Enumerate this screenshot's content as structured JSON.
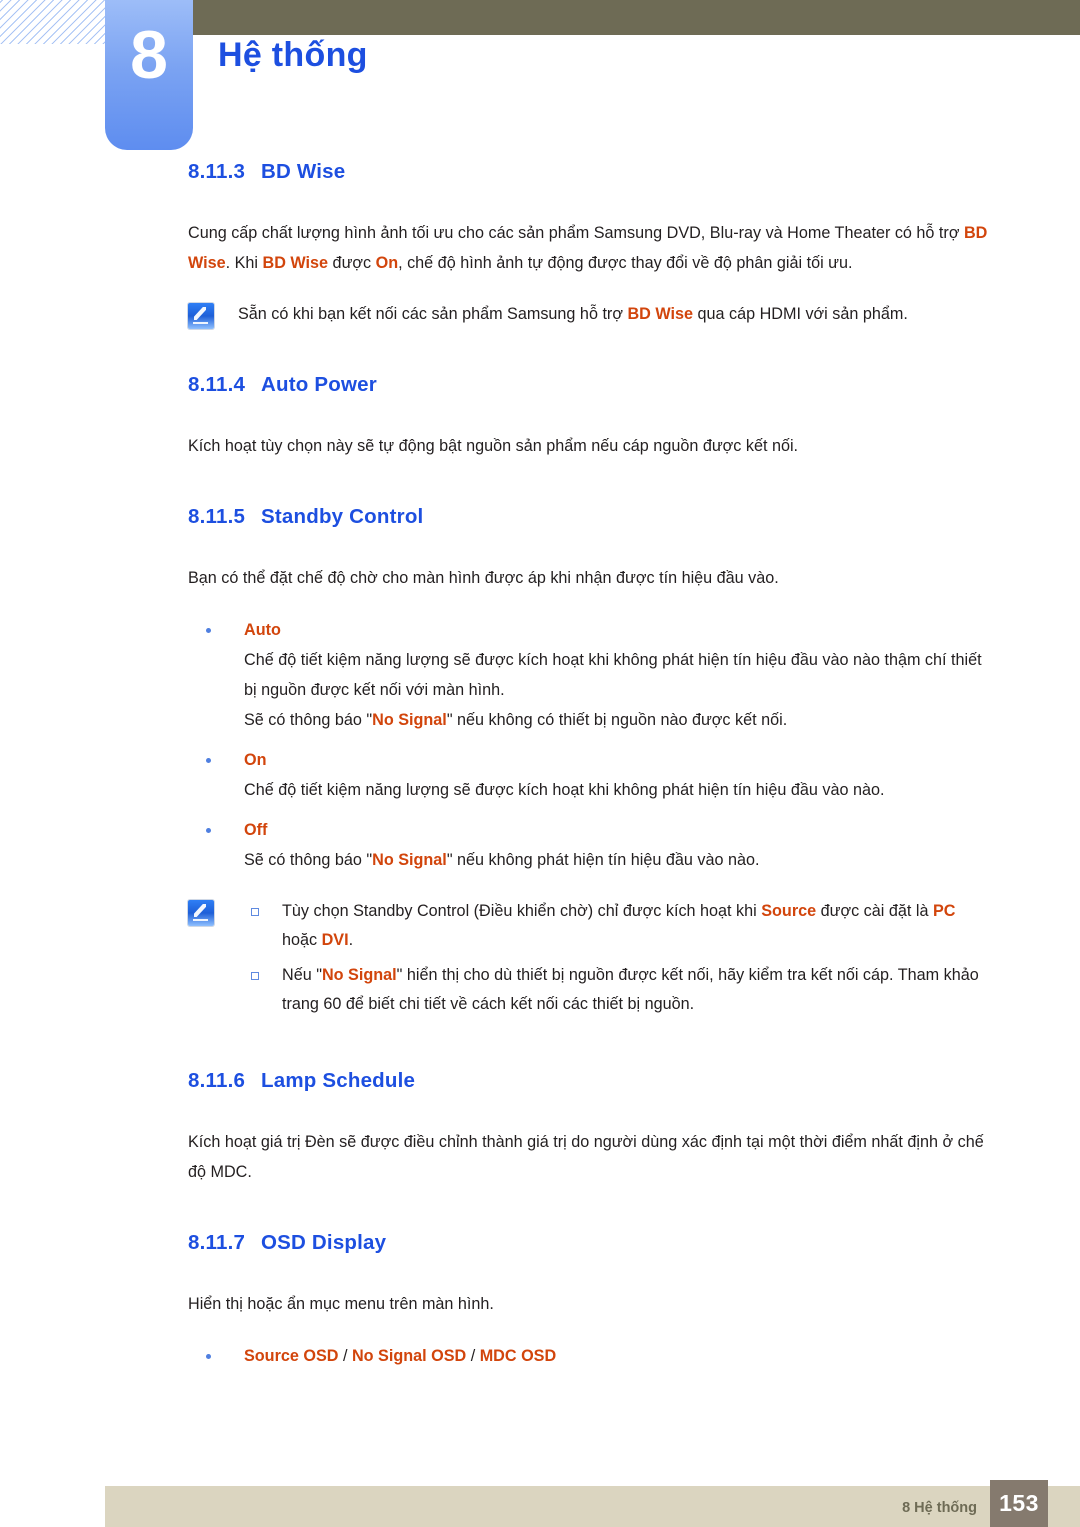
{
  "header": {
    "chapter_number": "8",
    "chapter_title": "Hệ thống",
    "accent_blue": "#1d4fe0",
    "tab_blue": "#7ba3f2",
    "olive": "#6e6b55"
  },
  "sections": [
    {
      "num": "8.11.3",
      "title": "BD Wise",
      "paragraph_parts": [
        {
          "t": "Cung cấp chất lượng hình ảnh tối ưu cho các sản phẩm Samsung DVD, Blu-ray và Home Theater có hỗ trợ ",
          "style": "normal"
        },
        {
          "t": "BD Wise",
          "style": "orange"
        },
        {
          "t": ". Khi ",
          "style": "normal"
        },
        {
          "t": "BD Wise",
          "style": "orange"
        },
        {
          "t": " được ",
          "style": "normal"
        },
        {
          "t": "On",
          "style": "orange"
        },
        {
          "t": ", chế độ hình ảnh tự động được thay đổi về độ phân giải tối ưu.",
          "style": "normal"
        }
      ]
    },
    {
      "num": "8.11.4",
      "title": "Auto Power",
      "paragraph": "Kích hoạt tùy chọn này sẽ tự động bật nguồn sản phẩm nếu cáp nguồn được kết nối."
    },
    {
      "num": "8.11.5",
      "title": "Standby Control",
      "paragraph": "Bạn có thể đặt chế độ chờ cho màn hình được áp khi nhận được tín hiệu đầu vào."
    },
    {
      "num": "8.11.6",
      "title": "Lamp Schedule",
      "paragraph": "Kích hoạt giá trị Đèn sẽ được điều chỉnh thành giá trị do người dùng xác định tại một thời điểm nhất định ở chế độ MDC."
    },
    {
      "num": "8.11.7",
      "title": "OSD Display",
      "paragraph": "Hiển thị hoặc ẩn mục menu trên màn hình."
    }
  ],
  "note1": {
    "icon": "note-pen-icon",
    "text_before": "Sẵn có khi bạn kết nối các sản phẩm Samsung hỗ trợ ",
    "highlight": "BD Wise",
    "text_after": " qua cáp HDMI với sản phẩm."
  },
  "standby_options": [
    {
      "label": "Auto",
      "lines": [
        "Chế độ tiết kiệm năng lượng sẽ được kích hoạt khi không phát hiện tín hiệu đầu vào nào thậm chí thiết bị nguồn được kết nối với màn hình.",
        "SIGNAL_LINE"
      ],
      "signal_line": {
        "before": "Sẽ có thông báo \"",
        "highlight": "No Signal",
        "after": "\" nếu không có thiết bị nguồn nào được kết nối."
      }
    },
    {
      "label": "On",
      "lines": [
        "Chế độ tiết kiệm năng lượng sẽ được kích hoạt khi không phát hiện tín hiệu đầu vào nào."
      ]
    },
    {
      "label": "Off",
      "lines": [
        "SIGNAL_LINE"
      ],
      "signal_line": {
        "before": "Sẽ có thông báo \"",
        "highlight": "No Signal",
        "after": "\" nếu không phát hiện tín hiệu đầu vào nào."
      }
    }
  ],
  "note2": {
    "icon": "note-pen-icon",
    "items": [
      {
        "p1": "Tùy chọn Standby Control (Điều khiển chờ) chỉ được kích hoạt khi ",
        "h1": "Source",
        "p2": " được cài đặt là ",
        "h2": "PC",
        "p3": " hoặc ",
        "h3": "DVI",
        "p4": "."
      },
      {
        "p1": "Nếu \"",
        "h1": "No Signal",
        "p2": "\" hiển thị cho dù thiết bị nguồn được kết nối, hãy kiểm tra kết nối cáp. Tham khảo trang 60 để biết chi tiết về cách kết nối các thiết bị nguồn."
      }
    ]
  },
  "osd_bullet": {
    "part1": "Source OSD",
    "sep1": " / ",
    "part2": "No Signal OSD",
    "sep2": " / ",
    "part3": "MDC OSD"
  },
  "footer": {
    "label": "8 Hệ thống",
    "page_number": "153",
    "bar_color": "#dbd5c0",
    "page_box_color": "#857a6e"
  }
}
